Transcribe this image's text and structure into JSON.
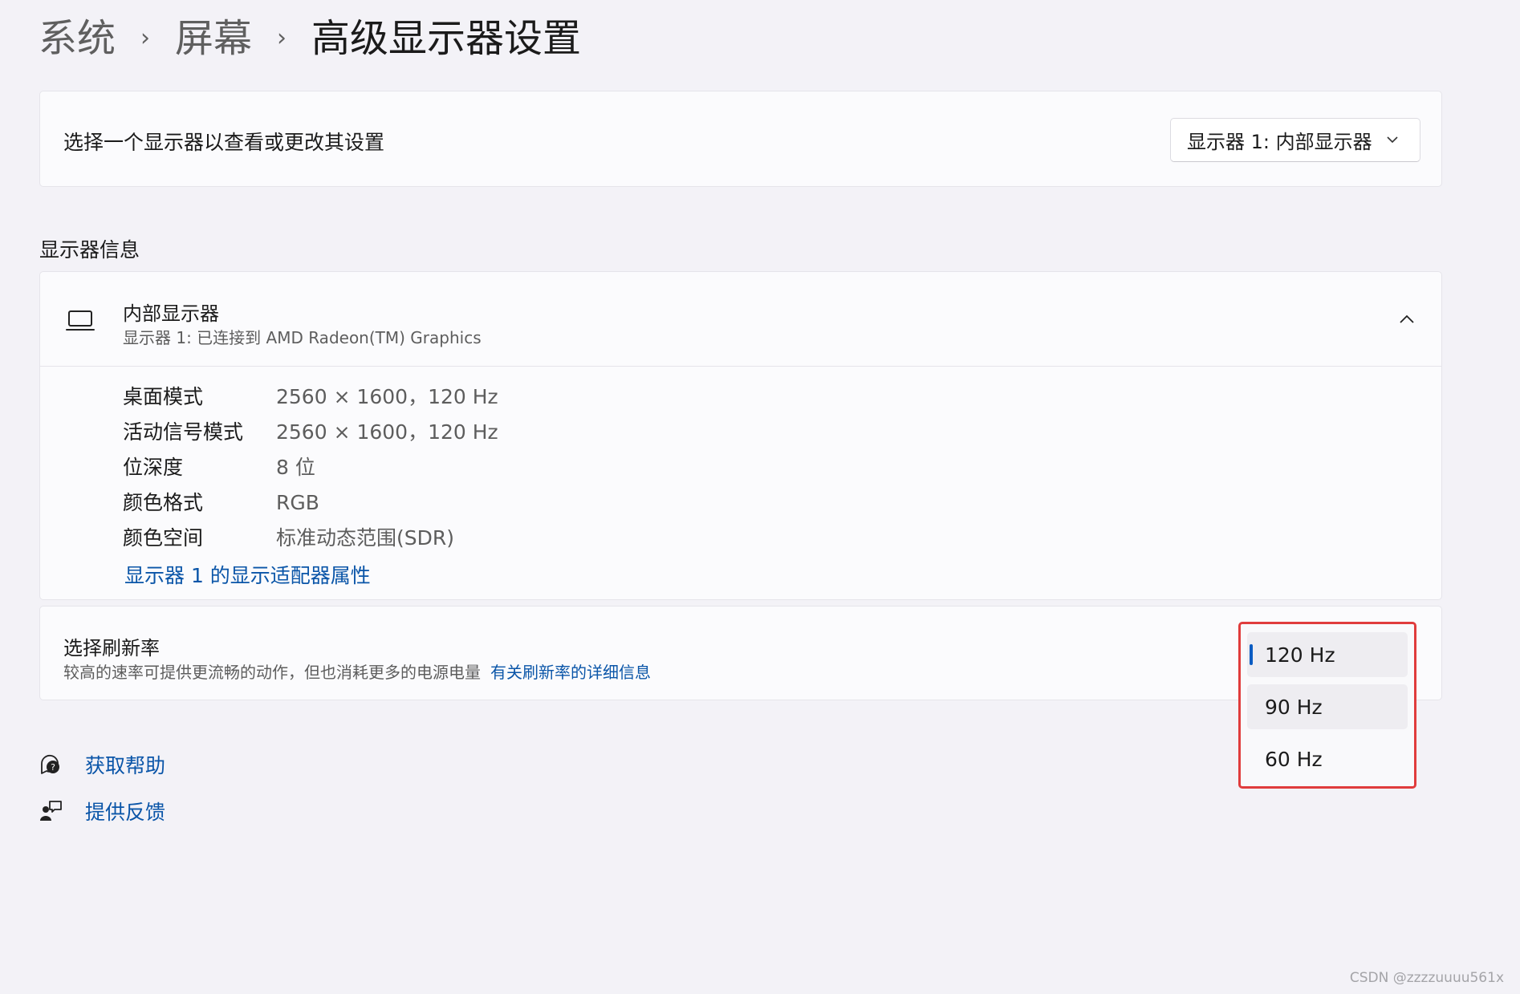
{
  "breadcrumb": {
    "items": [
      "系统",
      "屏幕"
    ],
    "separator": "›",
    "current": "高级显示器设置"
  },
  "display_select": {
    "label": "选择一个显示器以查看或更改其设置",
    "dropdown_value": "显示器 1: 内部显示器"
  },
  "display_info": {
    "section_title": "显示器信息",
    "header_title": "内部显示器",
    "header_subtitle": "显示器 1: 已连接到 AMD Radeon(TM) Graphics",
    "rows": [
      {
        "key": "桌面模式",
        "value": "2560 × 1600，120 Hz"
      },
      {
        "key": "活动信号模式",
        "value": "2560 × 1600，120 Hz"
      },
      {
        "key": "位深度",
        "value": "8 位"
      },
      {
        "key": "颜色格式",
        "value": "RGB"
      },
      {
        "key": "颜色空间",
        "value": "标准动态范围(SDR)"
      }
    ],
    "adapter_link": "显示器 1 的显示适配器属性"
  },
  "refresh_rate": {
    "title": "选择刷新率",
    "description": "较高的速率可提供更流畅的动作，但也消耗更多的电源电量",
    "link": "有关刷新率的详细信息",
    "options": [
      "120 Hz",
      "90 Hz",
      "60 Hz"
    ],
    "selected": "120 Hz"
  },
  "help_links": {
    "get_help": "获取帮助",
    "feedback": "提供反馈"
  },
  "watermark": "CSDN @zzzzuuuu561x",
  "colors": {
    "accent": "#0a5cc2",
    "link": "#0a55a8",
    "highlight_border": "#e03c3c",
    "background": "#f3f2f7"
  }
}
